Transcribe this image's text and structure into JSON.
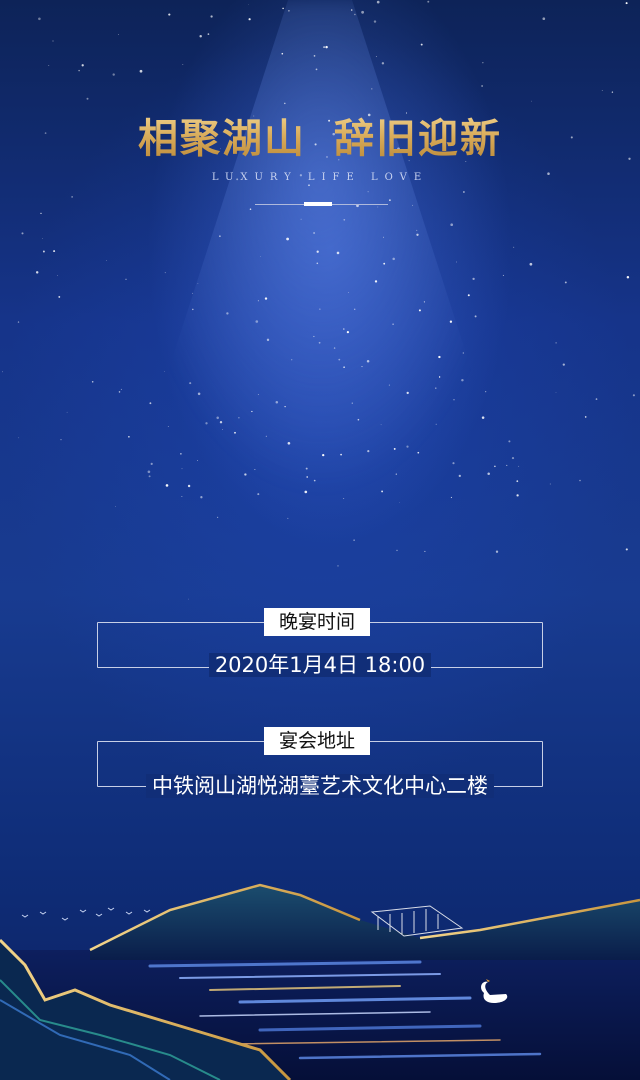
{
  "header": {
    "title": "相聚湖山  辞旧迎新",
    "subtitle": "LUXURY LIFE LOVE"
  },
  "banquet_time": {
    "label": "晚宴时间",
    "value": "2020年1月4日 18:00"
  },
  "banquet_venue": {
    "label": "宴会地址",
    "value": "中铁阅山湖悦湖薹艺术文化中心二楼"
  },
  "colors": {
    "gold": "#d7a957",
    "background": "#16348a",
    "box_border": "#c7cfe6"
  }
}
